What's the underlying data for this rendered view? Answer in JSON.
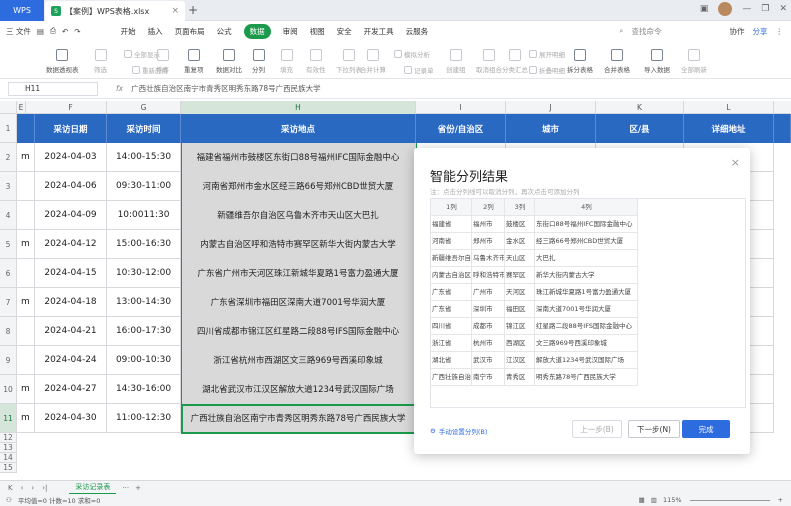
{
  "titlebar": {
    "app_tab": "WPS",
    "doc_tab": "【案例】WPS表格.xlsx",
    "doc_icon": "S",
    "new_tab": "+"
  },
  "menubar": {
    "file": "三 文件",
    "items": [
      "开始",
      "插入",
      "页面布局",
      "公式",
      "数据",
      "审阅",
      "视图",
      "安全",
      "开发工具",
      "云服务"
    ],
    "active": "数据",
    "search": "查找命令",
    "collab": "协作",
    "share": "分享"
  },
  "ribbon": {
    "items": [
      "数据透视表",
      "筛选",
      "全部显示",
      "重新应用",
      "排序",
      "重复项",
      "数据对比",
      "分列",
      "填充",
      "有效性",
      "下拉列表",
      "合并计算",
      "模拟分析",
      "记录单",
      "创建组",
      "取消组合",
      "分类汇总",
      "展开明细",
      "折叠明细",
      "拆分表格",
      "合并表格",
      "导入数据",
      "全部刷新"
    ]
  },
  "formula": {
    "namebox": "H11",
    "fx": "fx",
    "content": "广西壮族自治区南宁市青秀区明秀东路78号广西民族大学"
  },
  "grid": {
    "columns": [
      "E",
      "F",
      "G",
      "H",
      "I",
      "J",
      "K",
      "L"
    ],
    "header_row": [
      "采访日期",
      "采访时间",
      "采访地点",
      "省份/自治区",
      "城市",
      "区/县",
      "详细地址"
    ],
    "rows": [
      {
        "n": "2",
        "e": "m",
        "date": "2024-04-03",
        "time": "14:00-15:30",
        "loc": "福建省福州市鼓楼区东街口88号福州IFC国际金融中心"
      },
      {
        "n": "3",
        "e": "",
        "date": "2024-04-06",
        "time": "09:30-11:00",
        "loc": "河南省郑州市金水区经三路66号郑州CBD世贸大厦"
      },
      {
        "n": "4",
        "e": "",
        "date": "2024-04-09",
        "time": "10:0011:30",
        "loc": "新疆维吾尔自治区乌鲁木齐市天山区大巴扎"
      },
      {
        "n": "5",
        "e": "m",
        "date": "2024-04-12",
        "time": "15:00-16:30",
        "loc": "内蒙古自治区呼和浩特市赛罕区新华大街内蒙古大学"
      },
      {
        "n": "6",
        "e": "",
        "date": "2024-04-15",
        "time": "10:30-12:00",
        "loc": "广东省广州市天河区珠江新城华夏路1号富力盈通大厦"
      },
      {
        "n": "7",
        "e": "m",
        "date": "2024-04-18",
        "time": "13:00-14:30",
        "loc": "广东省深圳市福田区深南大道7001号华润大厦"
      },
      {
        "n": "8",
        "e": "",
        "date": "2024-04-21",
        "time": "16:00-17:30",
        "loc": "四川省成都市锦江区红星路二段88号IFS国际金融中心"
      },
      {
        "n": "9",
        "e": "",
        "date": "2024-04-24",
        "time": "09:00-10:30",
        "loc": "浙江省杭州市西湖区文三路969号西溪印象城"
      },
      {
        "n": "10",
        "e": "m",
        "date": "2024-04-27",
        "time": "14:30-16:00",
        "loc": "湖北省武汉市江汉区解放大道1234号武汉国际广场"
      },
      {
        "n": "11",
        "e": "m",
        "date": "2024-04-30",
        "time": "11:00-12:30",
        "loc": "广西壮族自治区南宁市青秀区明秀东路78号广西民族大学"
      }
    ],
    "empty_rows": [
      "12",
      "13",
      "14",
      "15"
    ],
    "row1": "1"
  },
  "dialog": {
    "title": "智能分列结果",
    "hint": "注：点击分列线可以取消分列，再次点击可添加分列",
    "cols": [
      "1列",
      "2列",
      "3列",
      "4列"
    ],
    "rows": [
      [
        "福建省",
        "福州市",
        "鼓楼区",
        "东街口88号福州IFC国际金融中心"
      ],
      [
        "河南省",
        "郑州市",
        "金水区",
        "经三路66号郑州CBD世贸大厦"
      ],
      [
        "新疆维吾尔自治区",
        "乌鲁木齐市",
        "天山区",
        "大巴扎"
      ],
      [
        "内蒙古自治区",
        "呼和浩特市",
        "赛罕区",
        "新华大街内蒙古大学"
      ],
      [
        "广东省",
        "广州市",
        "天河区",
        "珠江新城华夏路1号富力盈通大厦"
      ],
      [
        "广东省",
        "深圳市",
        "福田区",
        "深南大道7001号华润大厦"
      ],
      [
        "四川省",
        "成都市",
        "锦江区",
        "红星路二段88号IFS国际金融中心"
      ],
      [
        "浙江省",
        "杭州市",
        "西湖区",
        "文三路969号西溪印象城"
      ],
      [
        "湖北省",
        "武汉市",
        "江汉区",
        "解放大道1234号武汉国际广场"
      ],
      [
        "广西壮族自治区",
        "南宁市",
        "青秀区",
        "明秀东路78号广西民族大学"
      ]
    ],
    "manual_link": "手动设置分列(B)",
    "prev": "上一步(B)",
    "next": "下一步(N)",
    "done": "完成",
    "close": "×"
  },
  "sheetbar": {
    "sheet": "采访记录表",
    "more": "···",
    "add": "+"
  },
  "status": {
    "stats": "平均值=0  计数=10  求和=0",
    "zoom": "115%"
  },
  "colors": {
    "header_blue": "#2a69c1",
    "accent_green": "#1c9a4c",
    "primary_blue": "#2d6cdf"
  }
}
